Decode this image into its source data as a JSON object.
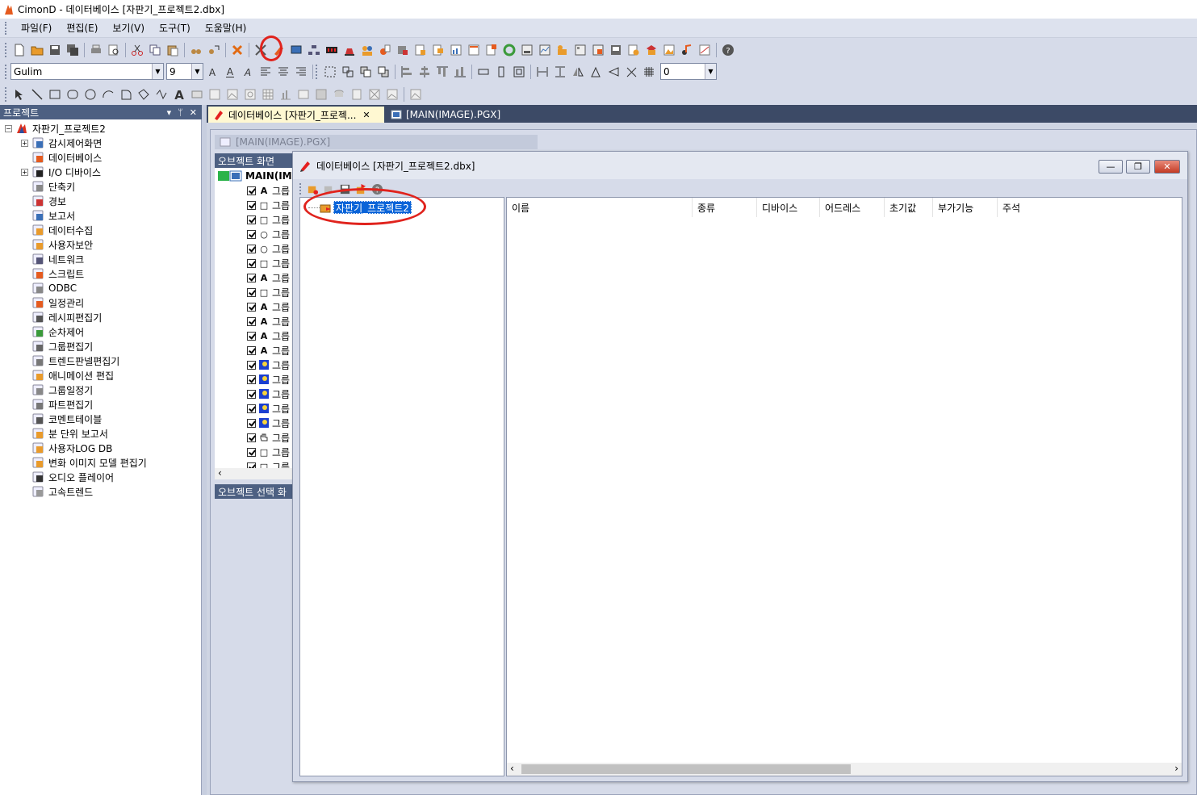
{
  "window": {
    "title": "CimonD - 데이터베이스 [자판기_프로젝트2.dbx]"
  },
  "menu": [
    "파일(F)",
    "편집(E)",
    "보기(V)",
    "도구(T)",
    "도움말(H)"
  ],
  "format_toolbar": {
    "font": "Gulim",
    "size": "9",
    "value": "0"
  },
  "project_panel": {
    "title": "프로젝트",
    "pin": "ᛘ",
    "close": "✕",
    "dropdown": "▾",
    "root": "자판기_프로젝트2",
    "items": [
      "감시제어화면",
      "데이터베이스",
      "I/O 디바이스",
      "단축키",
      "경보",
      "보고서",
      "데이터수집",
      "사용자보안",
      "네트워크",
      "스크립트",
      "ODBC",
      "일정관리",
      "레시피편집기",
      "순차제어",
      "그룹편집기",
      "트렌드판넬편집기",
      "애니메이션 편집",
      "그룹일정기",
      "파트편집기",
      "코멘트테이블",
      "분 단위 보고서",
      "사용자LOG DB",
      "변화 이미지 모델 편집기",
      "오디오 플레이어",
      "고속트렌드"
    ],
    "expand_mark": "+"
  },
  "tabs": [
    {
      "label": "데이터베이스 [자판기_프로젝...",
      "close": "✕"
    },
    {
      "label": "[MAIN(IMAGE).PGX]"
    }
  ],
  "inner_doc": {
    "title": "[MAIN(IMAGE).PGX]"
  },
  "object_panel": {
    "title": "오브젝트 화면",
    "root": "MAIN(IM",
    "item_label": "그릅",
    "shapes": [
      "A",
      "□",
      "□",
      "○",
      "○",
      "□",
      "A",
      "□",
      "A",
      "A",
      "A",
      "A",
      "img",
      "img",
      "img",
      "img",
      "img",
      "hand",
      "□",
      "□"
    ],
    "select_title": "오브젝트 선택 화"
  },
  "db_dialog": {
    "title": "데이터베이스 [자판기_프로젝트2.dbx]",
    "minimize": "—",
    "maximize": "❐",
    "close": "✕",
    "tree_root": "자판기_프로젝트2",
    "columns": [
      "이름",
      "종류",
      "디바이스",
      "어드레스",
      "초기값",
      "부가기능",
      "주석"
    ],
    "scroll_left": "‹",
    "scroll_right": "›"
  },
  "colors": {
    "panel_header": "#4d6082",
    "selection": "#0a64d8",
    "annotation": "#e0231d",
    "active_tab": "#fff8d2"
  }
}
